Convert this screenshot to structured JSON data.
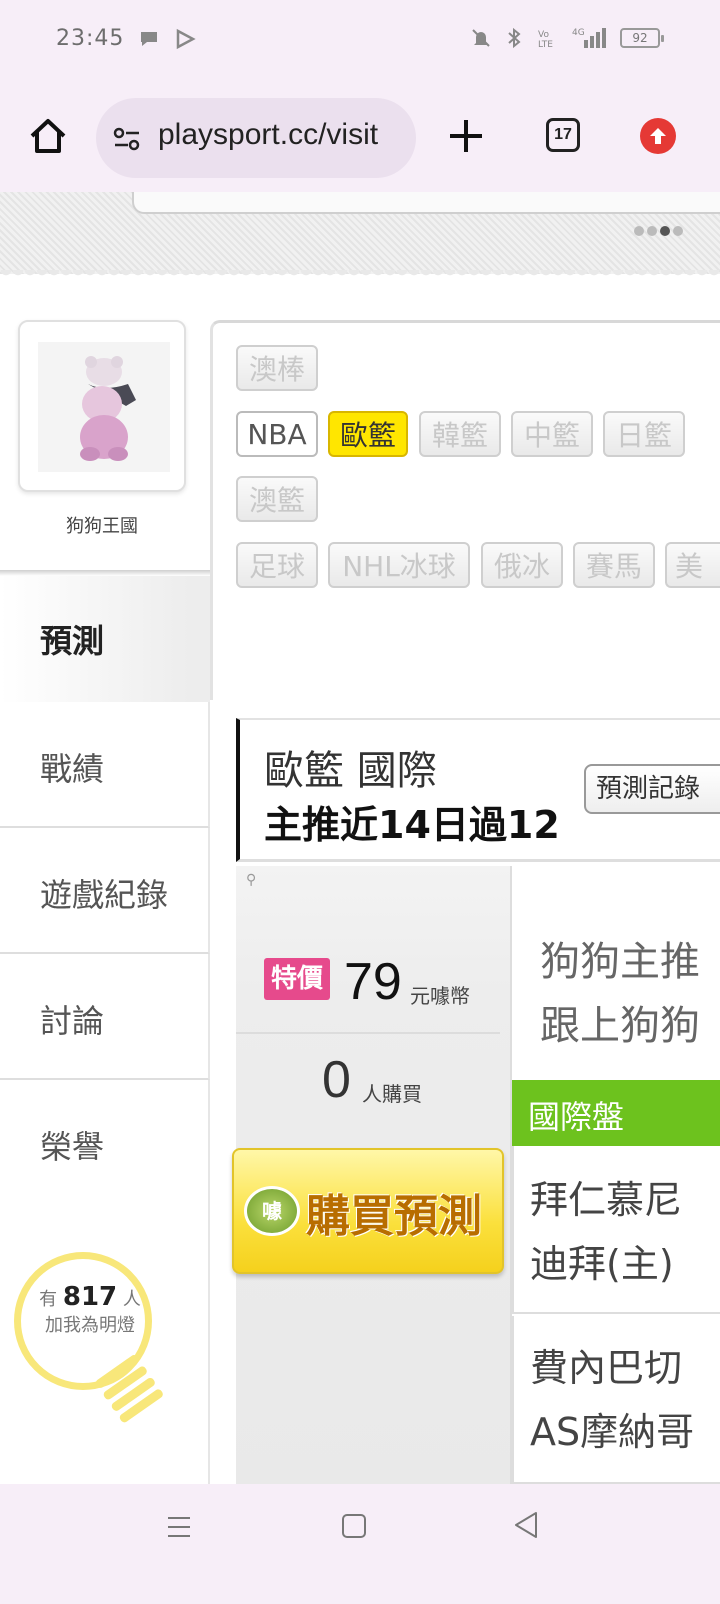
{
  "status": {
    "time": "23:45",
    "battery": "92"
  },
  "browser": {
    "url": "playsport.cc/visit",
    "tab_count": "17"
  },
  "profile": {
    "name": "狗狗王國"
  },
  "nav": {
    "active": "預測",
    "items": [
      "戰績",
      "遊戲紀錄",
      "討論",
      "榮譽"
    ]
  },
  "fans": {
    "prefix": "有",
    "count": "817",
    "suffix": "人",
    "line2": "加我為明燈"
  },
  "tags": {
    "row1": [
      "澳棒"
    ],
    "row2": [
      "NBA",
      "歐籃",
      "韓籃",
      "中籃",
      "日籃"
    ],
    "row3": [
      "澳籃"
    ],
    "row4": [
      "足球",
      "NHL冰球",
      "俄冰",
      "賽馬",
      "美"
    ]
  },
  "card": {
    "title": "歐籃 國際",
    "subtitle": "主推近14日過12",
    "record_button": "預測記錄",
    "special_badge": "特價",
    "price": "79",
    "price_unit": "元噱幣",
    "buyers": "0",
    "buyers_label": "人購買",
    "buy_button": "購買預測",
    "buy_seal": "噱",
    "desc_line1": "狗狗主推",
    "desc_line2": "跟上狗狗",
    "market": "國際盤",
    "match1_line1": "拜仁慕尼",
    "match1_line2": "迪拜(主)",
    "match2_line1": "費內巴切",
    "match2_line2": "AS摩納哥"
  }
}
